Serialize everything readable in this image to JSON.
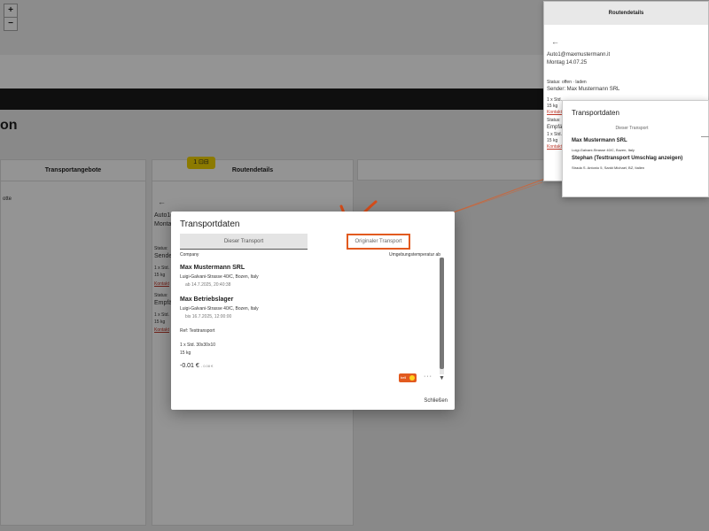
{
  "page": {
    "title": "on"
  },
  "panels": {
    "left": {
      "header": "Transportangebote",
      "row_text": "otte"
    },
    "middle": {
      "header": "Routendetails",
      "back_icon": "arrow-left-icon",
      "line1": "Auto1(",
      "line2": "Monta",
      "status": "Status:",
      "sender": "Sender",
      "row1": "1 x Std.",
      "row2": "15 kg",
      "link1": "Kontakt",
      "status2": "Status:",
      "receiver": "Empfä",
      "row3": "1 x Std.",
      "row4": "15 kg",
      "link2": "Kontakt"
    },
    "map": {
      "zoom_in": "+",
      "zoom_out": "−",
      "marker": "1 ⊡⊟"
    }
  },
  "modal": {
    "title": "Transportdaten",
    "tab_current": "Dieser Transport",
    "tab_original": "Originaler Transport",
    "col_company": "Company",
    "col_temp": "Umgebungstemperatur ab",
    "sender": {
      "name": "Max Mustermann SRL",
      "address": "Luigi-Galvani-Strasse 40/C, Bozen, Italy",
      "time": "ab 14.7.2025, 20:40:38"
    },
    "receiver": {
      "name": "Max Betriebslager",
      "address": "Luigi-Galvani-Strasse 40/C, Bozen, Italy",
      "time": "bis 16.7.2025, 12:00:00"
    },
    "ref": "Ref: Testtransport",
    "pallet": "1 x Std. 30x30x10",
    "weight": "15 kg",
    "price": "-0.01 €",
    "price_small": "- 0.08 €",
    "status_chip": "bell",
    "more": "···",
    "scroll_down": "▼",
    "close": "Schließen"
  },
  "inset": {
    "header": "Routendetails",
    "back_icon": "arrow-left-icon",
    "email": "Auto1@maxmustermann.it",
    "date": "Montag 14.07.25",
    "status": "Status: offen · laden",
    "sender": "Sender: Max Mustermann SRL",
    "row1": "1 x Std.",
    "row2": "15 kg",
    "link1": "Kontakt",
    "status2": "Status:",
    "receiver": "Empfä",
    "row3": "1 x Std.",
    "row4": "15 kg",
    "link2": "Kontakt",
    "modal_title": "Transportdaten",
    "modal_tab": "Dieser Transport",
    "modal_name1": "Max Mustermann SRL",
    "modal_addr1": "Luigi-Galvani-Strasse 40/C, Bozen, Italy",
    "modal_name2": "Stephan (Testtransport Umschlag anzeigen)",
    "modal_addr2": "Strada S. Antonio 5, Sankt Michael, BZ, Italien"
  },
  "colors": {
    "accent": "#e25a1f",
    "link": "#c0392b",
    "dark_bar": "#1a1a1a"
  }
}
